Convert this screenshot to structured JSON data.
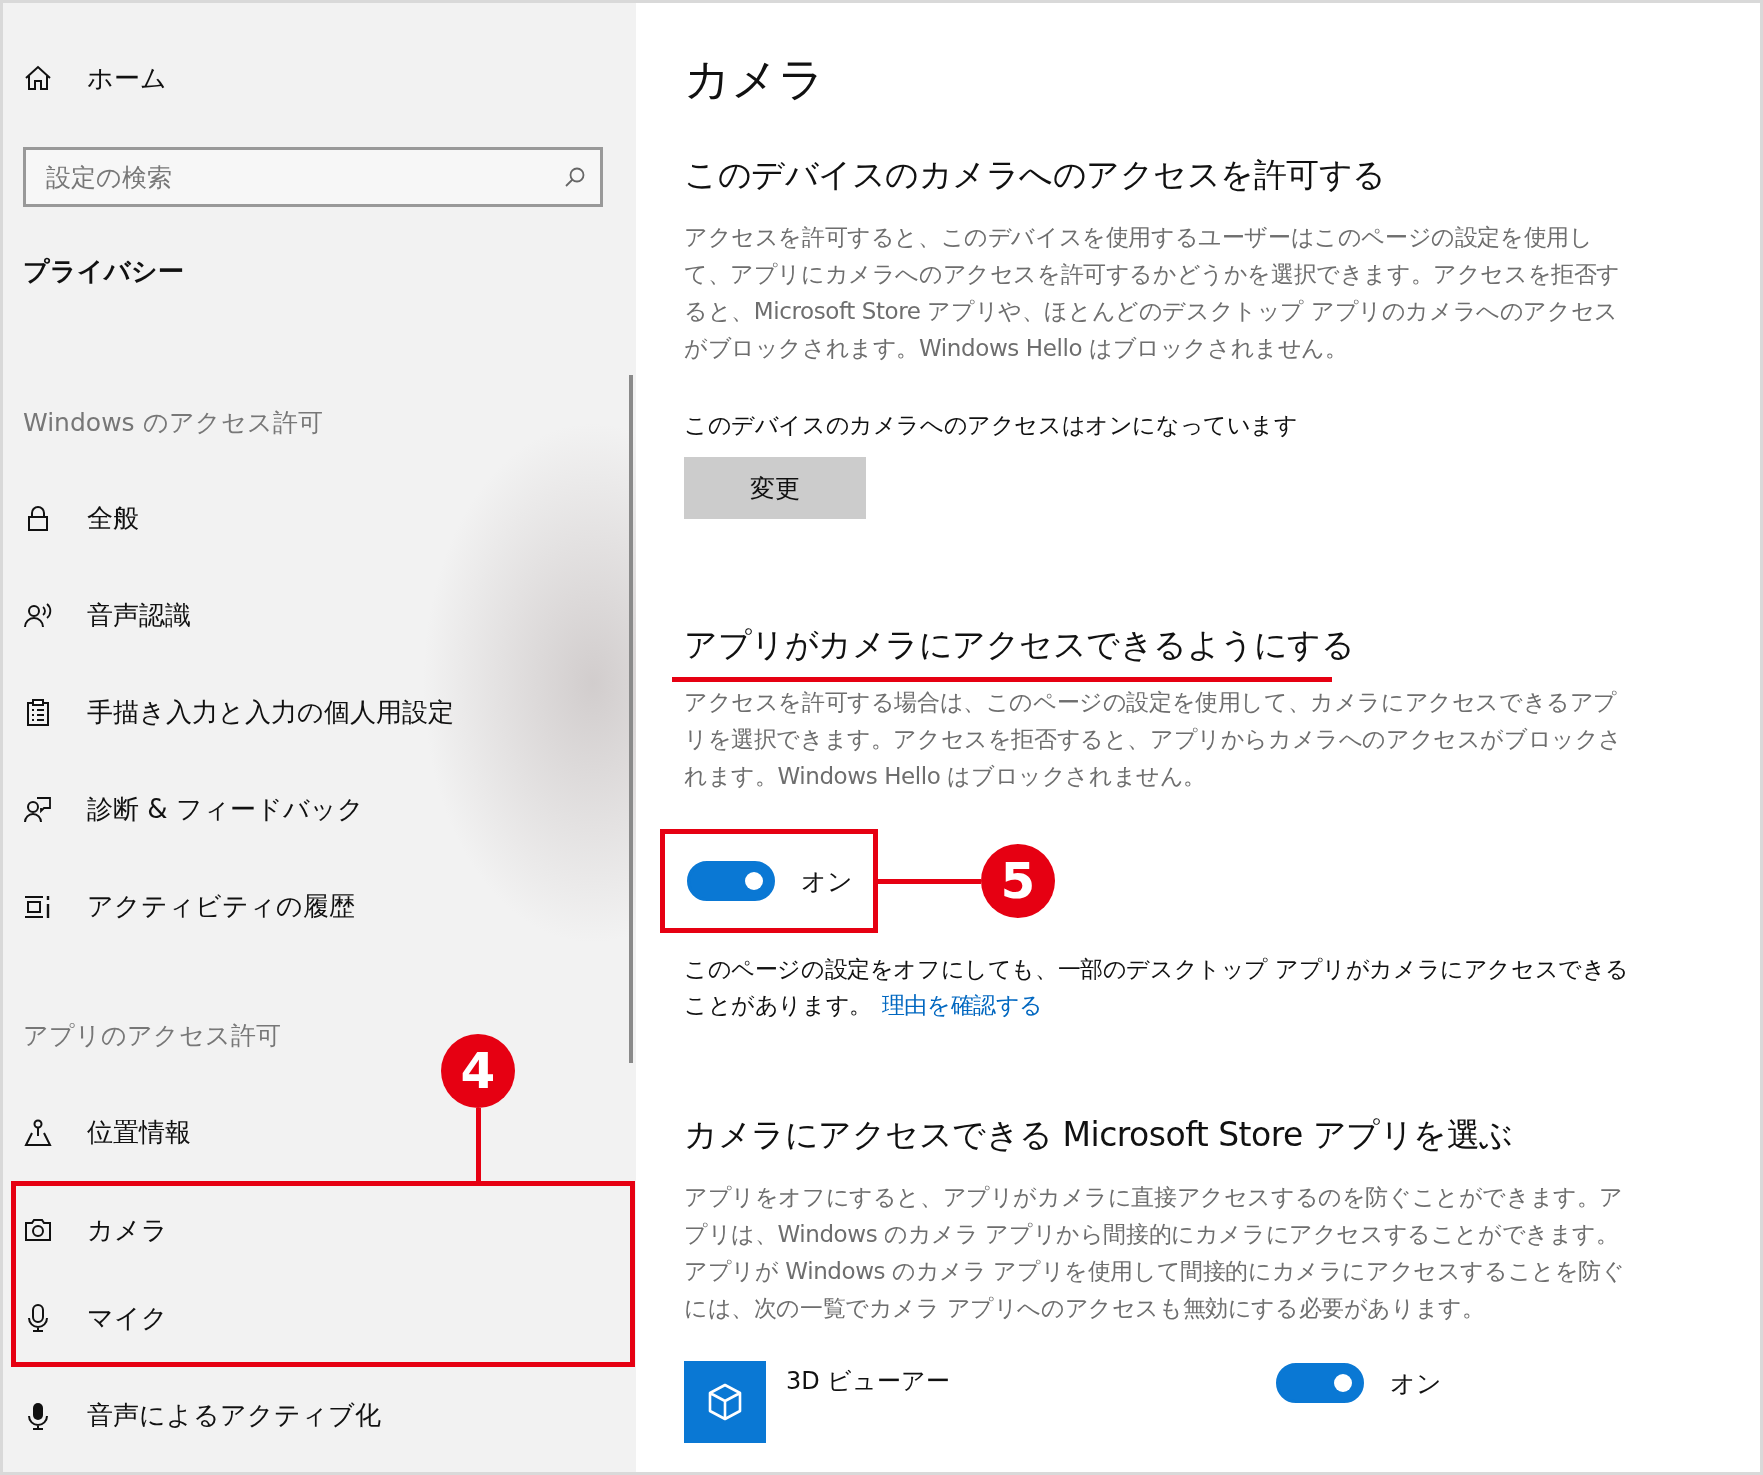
{
  "sidebar": {
    "home": {
      "label": "ホーム"
    },
    "search": {
      "placeholder": "設定の検索"
    },
    "title": "プライバシー",
    "groups": [
      {
        "heading": "Windows のアクセス許可",
        "items": [
          {
            "label": "全般",
            "kind": "lock",
            "highlighted": false
          },
          {
            "label": "音声認識",
            "kind": "speech",
            "highlighted": false
          },
          {
            "label": "手描き入力と入力の個人用設定",
            "kind": "clipboard",
            "highlighted": false
          },
          {
            "label": "診断 & フィードバック",
            "kind": "feedback",
            "highlighted": false
          },
          {
            "label": "アクティビティの履歴",
            "kind": "timeline",
            "highlighted": false
          }
        ]
      },
      {
        "heading": "アプリのアクセス許可",
        "callout": "4",
        "items": [
          {
            "label": "位置情報",
            "kind": "location",
            "highlighted": false
          },
          {
            "label": "カメラ",
            "kind": "camera",
            "highlighted": true
          },
          {
            "label": "マイク",
            "kind": "mic",
            "highlighted": true
          },
          {
            "label": "音声によるアクティブ化",
            "kind": "voice",
            "highlighted": false
          }
        ]
      }
    ]
  },
  "content": {
    "title": "カメラ",
    "device_access": {
      "heading": "このデバイスのカメラへのアクセスを許可する",
      "description": "アクセスを許可すると、このデバイスを使用するユーザーはこのページの設定を使用して、アプリにカメラへのアクセスを許可するかどうかを選択できます。アクセスを拒否すると、Microsoft Store アプリや、ほとんどのデスクトップ アプリのカメラへのアクセスがブロックされます。Windows Hello はブロックされません。",
      "status": "このデバイスのカメラへのアクセスはオンになっています",
      "button": "変更"
    },
    "app_access": {
      "heading": "アプリがカメラにアクセスできるようにする",
      "underlined": true,
      "description": "アクセスを許可する場合は、このページの設定を使用して、カメラにアクセスできるアプリを選択できます。アクセスを拒否すると、アプリからカメラへのアクセスがブロックされます。Windows Hello はブロックされません。",
      "toggle": {
        "on": true,
        "label": "オン"
      },
      "callout": "5",
      "note": "このページの設定をオフにしても、一部のデスクトップ アプリがカメラにアクセスできることがあります。",
      "link": "理由を確認する"
    },
    "store_apps": {
      "heading": "カメラにアクセスできる Microsoft Store アプリを選ぶ",
      "description": "アプリをオフにすると、アプリがカメラに直接アクセスするのを防ぐことができます。アプリは、Windows のカメラ アプリから間接的にカメラにアクセスすることができます。アプリが Windows のカメラ アプリを使用して間接的にカメラにアクセスすることを防ぐには、次の一覧でカメラ アプリへのアクセスも無効にする必要があります。",
      "apps": [
        {
          "name": "3D ビューアー",
          "on": true,
          "label": "オン"
        }
      ]
    }
  }
}
